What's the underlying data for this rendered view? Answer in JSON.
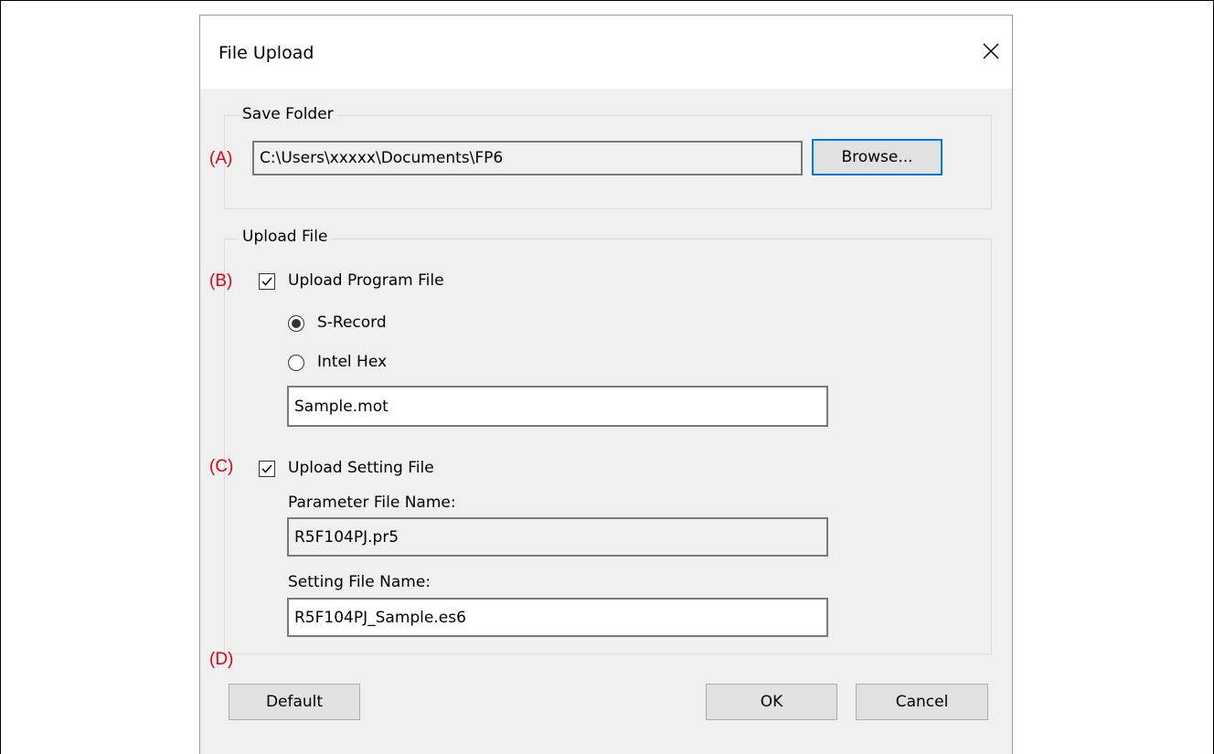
{
  "dialog": {
    "title": "File Upload",
    "close_icon": "close-icon"
  },
  "save_folder": {
    "group_label": "Save Folder",
    "mark": "(A)",
    "path_value": "C:\\Users\\xxxxx\\Documents\\FP6",
    "browse_label": "Browse..."
  },
  "upload_file": {
    "group_label": "Upload File",
    "program": {
      "mark": "(B)",
      "checkbox_label": "Upload Program File",
      "checked": true,
      "format_options": [
        {
          "label": "S-Record",
          "selected": true
        },
        {
          "label": "Intel Hex",
          "selected": false
        }
      ],
      "file_name_value": "Sample.mot"
    },
    "setting": {
      "mark": "(C)",
      "checkbox_label": "Upload Setting File",
      "checked": true,
      "parameter_label": "Parameter File Name:",
      "parameter_value": "R5F104PJ.pr5",
      "setting_label": "Setting File Name:",
      "setting_value": "R5F104PJ_Sample.es6"
    }
  },
  "footer": {
    "mark": "(D)",
    "default_label": "Default",
    "ok_label": "OK",
    "cancel_label": "Cancel"
  },
  "colors": {
    "annotation_mark": "#e60012",
    "focus_border": "#0078d7",
    "dialog_background": "#f0f0f0"
  }
}
